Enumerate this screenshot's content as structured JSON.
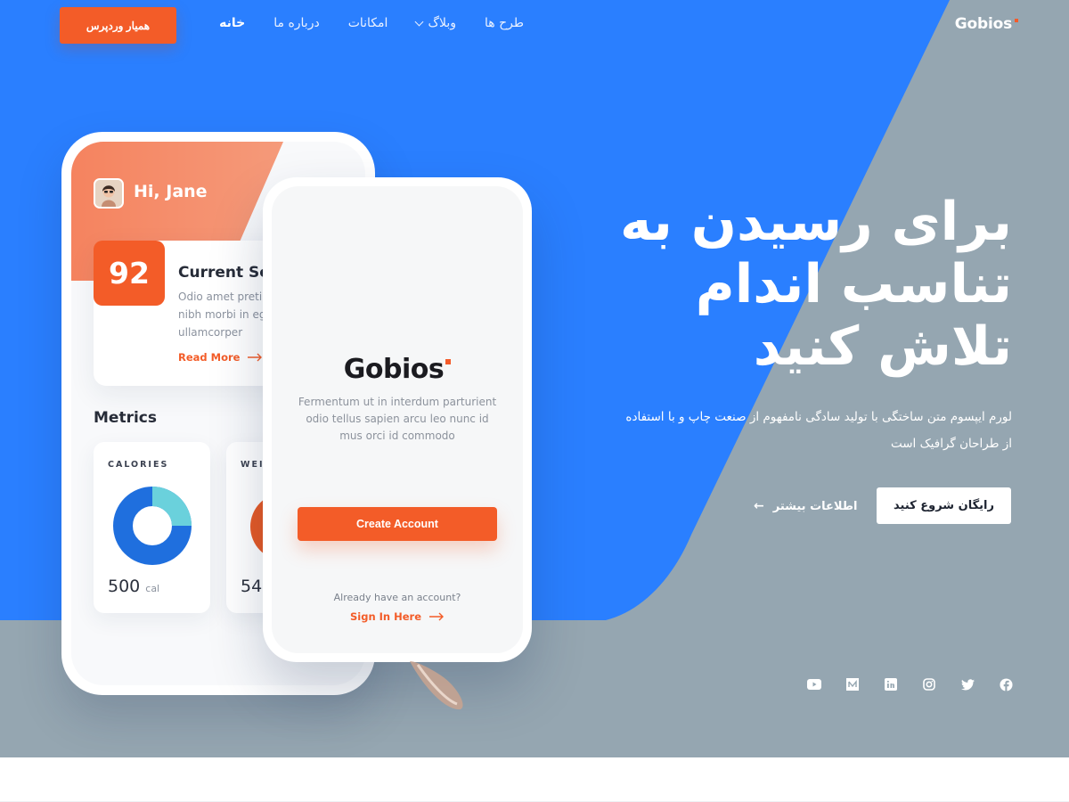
{
  "header": {
    "logo": "Gobios",
    "nav": [
      {
        "label": "خانه",
        "active": true,
        "dropdown": false
      },
      {
        "label": "درباره ما",
        "active": false,
        "dropdown": false
      },
      {
        "label": "امکانات",
        "active": false,
        "dropdown": false
      },
      {
        "label": "وبلاگ",
        "active": false,
        "dropdown": true
      },
      {
        "label": "طرح ها",
        "active": false,
        "dropdown": false
      }
    ],
    "cta": "همیار وردپرس"
  },
  "hero": {
    "headline": "برای رسیدن به تناسب اندام تلاش کنید",
    "paragraph": "لورم ایپسوم متن ساختگی با تولید سادگی نامفهوم از صنعت چاپ و با استفاده از طراحان گرافیک است",
    "primary_button": "رایگان شروع کنید",
    "secondary_button": "اطلاعات بیشتر",
    "socials": [
      "youtube-icon",
      "medium-icon",
      "linkedin-icon",
      "instagram-icon",
      "twitter-icon",
      "facebook-icon"
    ]
  },
  "phone_dashboard": {
    "greeting": "Hi, Jane",
    "score": "92",
    "score_title": "Current Score",
    "score_text": "Odio amet pretium sed nibh morbi in eget ullamcorper",
    "read_more": "Read More",
    "metrics_title": "Metrics",
    "calories_label": "CALORIES",
    "calories_value": "500",
    "calories_unit": "cal",
    "calories_share": 0.75,
    "weight_label": "WEIGHT",
    "weight_value": "54"
  },
  "phone_signup": {
    "logo": "Gobios",
    "text": "Fermentum ut in interdum parturient odio tellus sapien arcu leo nunc id mus orci id commodo",
    "create_account": "Create Account",
    "already": "Already have an account?",
    "sign_in": "Sign In Here"
  },
  "colors": {
    "blue": "#2a7fff",
    "gray": "#95a6b1",
    "orange": "#f35c28"
  }
}
